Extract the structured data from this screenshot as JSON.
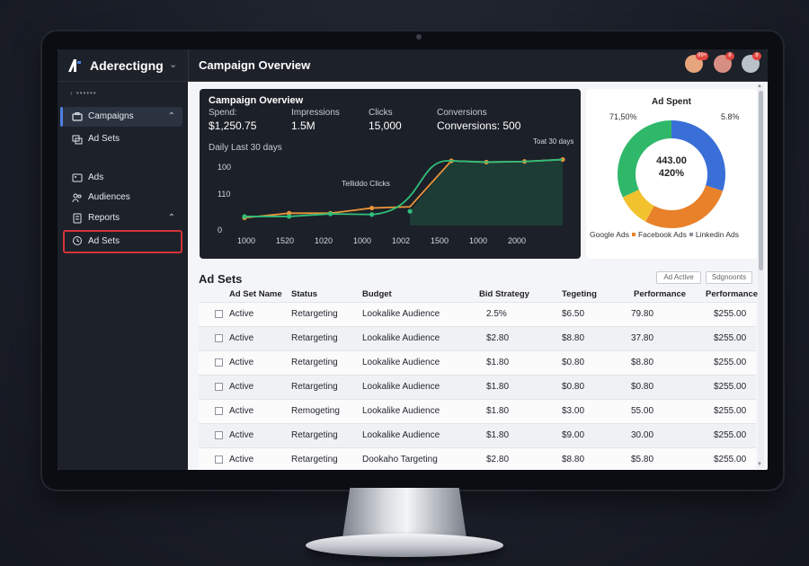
{
  "app": {
    "name": "Aderectigng",
    "page_title": "Campaign Overview"
  },
  "header": {
    "avatars": [
      {
        "badge": "99+",
        "color": "#e6a57c"
      },
      {
        "badge": "8",
        "color": "#d88f83"
      },
      {
        "badge": "8",
        "color": "#b9c2c8"
      }
    ]
  },
  "sidebar": {
    "back": "‹ ••••••",
    "items": [
      {
        "label": "Campaigns",
        "icon": "briefcase-icon",
        "chevron": "^",
        "state": "active"
      },
      {
        "label": "Ad Sets",
        "icon": "stack-icon",
        "chevron": "",
        "state": "normal"
      },
      {
        "label": "Ads",
        "icon": "image-icon",
        "chevron": "",
        "state": "normal"
      },
      {
        "label": "Audiences",
        "icon": "users-icon",
        "chevron": "",
        "state": "normal"
      },
      {
        "label": "Reports",
        "icon": "doc-icon",
        "chevron": "^",
        "state": "normal"
      },
      {
        "label": "Ad Sets",
        "icon": "clock-icon",
        "chevron": "",
        "state": "highlighted"
      }
    ]
  },
  "overview": {
    "title": "Campaign Overview",
    "stats": [
      {
        "label": "Spend:",
        "value": "$1,250.75"
      },
      {
        "label": "Impressions",
        "value": "1.5M"
      },
      {
        "label": "Clicks",
        "value": "15,000"
      },
      {
        "label": "Conversions",
        "value": "Conversions: 500"
      }
    ],
    "chart_subtitle": "Daily Last 30 days",
    "chart_note": "Toat 30 days"
  },
  "donut": {
    "title": "Ad Spent",
    "label_left": "71,50%",
    "label_right": "5.8%",
    "center_value": "443.00",
    "center_percent": "420%",
    "legend": [
      {
        "label": "Google Ads",
        "color": "#3a6fd8"
      },
      {
        "label": "Facebook Ads",
        "color": "#e8812a"
      },
      {
        "label": "Linkedin Ads",
        "color": "#8a8f98"
      }
    ]
  },
  "adsets": {
    "title": "Ad Sets",
    "buttons": {
      "active": "Ad Active",
      "segments": "Sdgnoonts"
    },
    "columns": [
      "Ad Set Name",
      "Status",
      "Budget",
      "Bid Strategy",
      "Tegeting",
      "Performance",
      "Performance"
    ],
    "rows": [
      [
        "Active",
        "Retargeting",
        "Lookalike Audience",
        "2.5%",
        "$6.50",
        "79.80",
        "$255.00"
      ],
      [
        "Active",
        "Retargeting",
        "Lookalike Audience",
        "$2.80",
        "$8.80",
        "37.80",
        "$255.00"
      ],
      [
        "Active",
        "Retargeting",
        "Lookalike Audience",
        "$1.80",
        "$0.80",
        "$8.80",
        "$255.00"
      ],
      [
        "Active",
        "Retargeting",
        "Lookalike Audience",
        "$1.80",
        "$0.80",
        "$0.80",
        "$255.00"
      ],
      [
        "Active",
        "Remogeting",
        "Lookalike Audience",
        "$1.80",
        "$3.00",
        "55.00",
        "$255.00"
      ],
      [
        "Active",
        "Retargeting",
        "Lookalike Audience",
        "$1.80",
        "$9.00",
        "30.00",
        "$255.00"
      ],
      [
        "Active",
        "Retargeting",
        "Dookaho Targeting",
        "$2.80",
        "$8.80",
        "$5.80",
        "$255.00"
      ]
    ]
  },
  "chart_data": [
    {
      "type": "line",
      "title": "Daily Last 30 days",
      "x_ticks": [
        "1000",
        "1520",
        "1020",
        "1000",
        "1002",
        "1500",
        "1000",
        "2000"
      ],
      "y_ticks": [
        "100",
        "110",
        "0"
      ],
      "annotation": "Telliddo Clicks",
      "series": [
        {
          "name": "",
          "color": "#e8953a",
          "values": [
            12,
            19,
            19,
            27,
            29,
            100,
            98,
            99,
            102
          ]
        },
        {
          "name": "",
          "color": "#2fbf7a",
          "values": [
            14,
            14,
            18,
            17,
            22,
            100,
            98,
            99,
            102
          ]
        }
      ],
      "grid": false
    },
    {
      "type": "pie",
      "title": "Ad Spent",
      "slices": [
        {
          "label": "Google Ads",
          "value": 30,
          "color": "#3a6fd8"
        },
        {
          "label": "Facebook Ads",
          "value": 28,
          "color": "#e8812a"
        },
        {
          "label": "",
          "value": 10,
          "color": "#f2c12e"
        },
        {
          "label": "",
          "value": 32,
          "color": "#2fb86a"
        }
      ]
    }
  ]
}
